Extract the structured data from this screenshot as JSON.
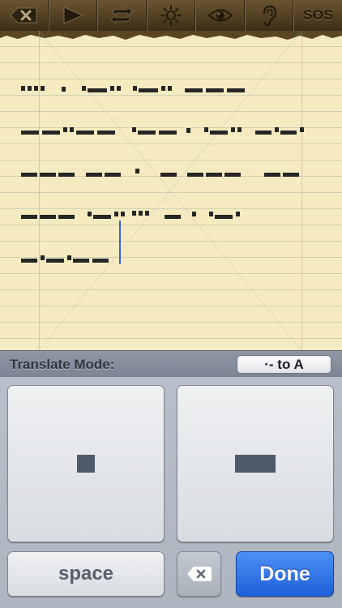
{
  "toolbar": {
    "buttons": [
      {
        "icon": "backspace-icon"
      },
      {
        "icon": "play-icon"
      },
      {
        "icon": "repeat-icon"
      },
      {
        "icon": "brightness-icon"
      },
      {
        "icon": "eye-icon"
      },
      {
        "icon": "ear-icon"
      },
      {
        "label": "SOS"
      }
    ]
  },
  "morse_text": [
    "···· · ·–·· ·–·· –––",
    "––··–– ·–– · ·–·· –·–·",
    "––– ––· · – ––– ––",
    "––– ·–·· ··· – · ·–·",
    "–·–·––"
  ],
  "mode_bar": {
    "label": "Translate Mode:",
    "mode_value": "·- to A"
  },
  "keys": {
    "space_label": "space",
    "done_label": "Done"
  },
  "colors": {
    "toolbar": "#564425",
    "paper": "#f6ebc0",
    "ink": "#2b2b2b",
    "cursor": "#3a5fd9",
    "done": "#2a6ee6"
  }
}
